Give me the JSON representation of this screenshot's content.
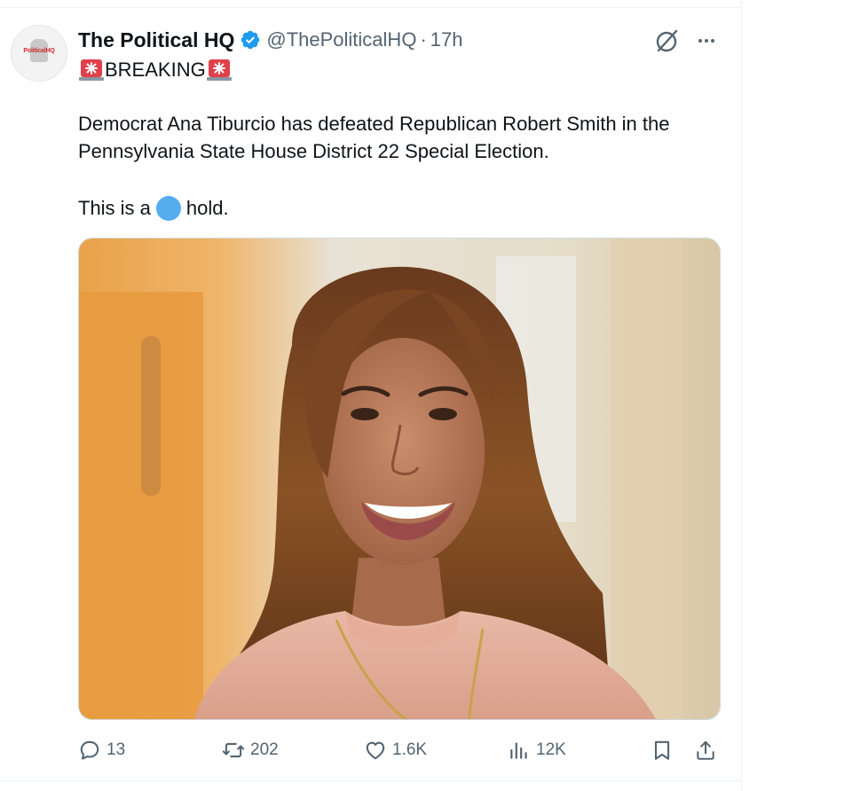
{
  "post": {
    "author": {
      "display_name": "The Political HQ",
      "handle": "@ThePoliticalHQ",
      "avatar_text": "PoliticalHQ",
      "verified_color": "#1d9bf0"
    },
    "time_separator": "·",
    "timestamp": "17h",
    "breaking_label": "BREAKING",
    "body": "Democrat Ana Tiburcio has defeated Republican Robert Smith in the Pennsylvania State House District 22 Special Election.",
    "hold_prefix": "This is a",
    "hold_suffix": "hold.",
    "hold_emoji_color": "#55acee",
    "media": {
      "kind": "photo",
      "icon": "portrait-photo"
    },
    "actions": {
      "replies": "13",
      "reposts": "202",
      "likes": "1.6K",
      "views": "12K"
    }
  },
  "colors": {
    "text_primary": "#0f1419",
    "text_secondary": "#536471",
    "accent": "#1d9bf0",
    "siren_red": "#e0404a"
  }
}
